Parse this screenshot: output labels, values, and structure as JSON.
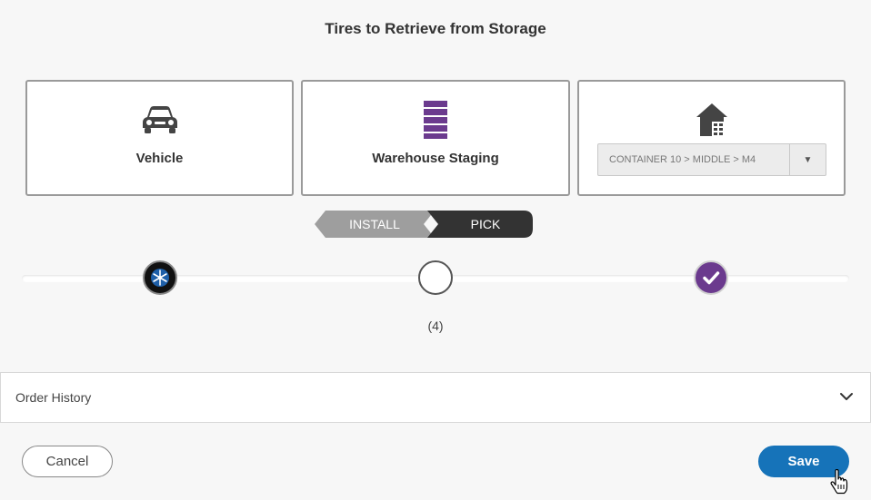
{
  "dialog": {
    "title": "Tires to Retrieve from Storage"
  },
  "locations": {
    "vehicle": {
      "label": "Vehicle",
      "icon": "car-icon"
    },
    "warehouse_staging": {
      "label": "Warehouse Staging",
      "icon": "storage-rack-icon"
    },
    "storage": {
      "icon": "warehouse-building-icon",
      "selected_value": "CONTAINER 10 > MIDDLE > M4"
    }
  },
  "mode_toggle": {
    "install_label": "INSTALL",
    "pick_label": "PICK",
    "active": "PICK"
  },
  "progress": {
    "count_label": "(4)",
    "active_step": 3
  },
  "order_history": {
    "label": "Order History"
  },
  "footer": {
    "cancel_label": "Cancel",
    "save_label": "Save"
  },
  "colors": {
    "accent_purple": "#6b3a8e",
    "save_blue": "#1673b9",
    "toggle_inactive": "#9e9e9e",
    "toggle_active": "#333333",
    "winter_tire_blue": "#1e5fa8"
  }
}
